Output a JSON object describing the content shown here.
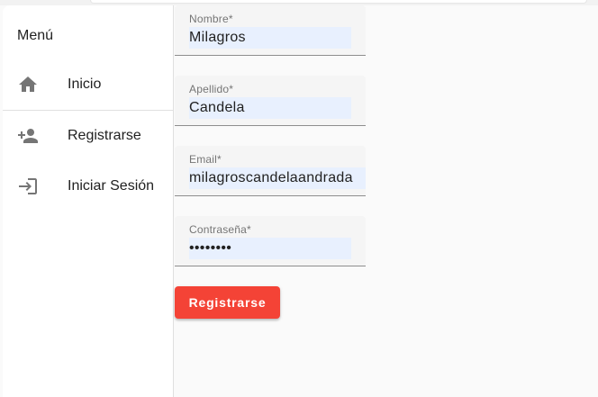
{
  "drawer": {
    "title": "Menú",
    "items": [
      {
        "label": "Inicio",
        "icon": "home-icon"
      },
      {
        "label": "Registrarse",
        "icon": "person-add-icon"
      },
      {
        "label": "Iniciar Sesión",
        "icon": "login-icon"
      }
    ]
  },
  "form": {
    "nombre": {
      "label": "Nombre*",
      "value": "Milagros"
    },
    "apellido": {
      "label": "Apellido*",
      "value": "Candela"
    },
    "email": {
      "label": "Email*",
      "value": "milagroscandelaandrada"
    },
    "password": {
      "label": "Contraseña*",
      "value": "••••••••"
    },
    "submit_label": "Registrarse"
  },
  "colors": {
    "accent": "#f44336",
    "autofill_bg": "#e8f0fe",
    "icon": "#757575"
  }
}
